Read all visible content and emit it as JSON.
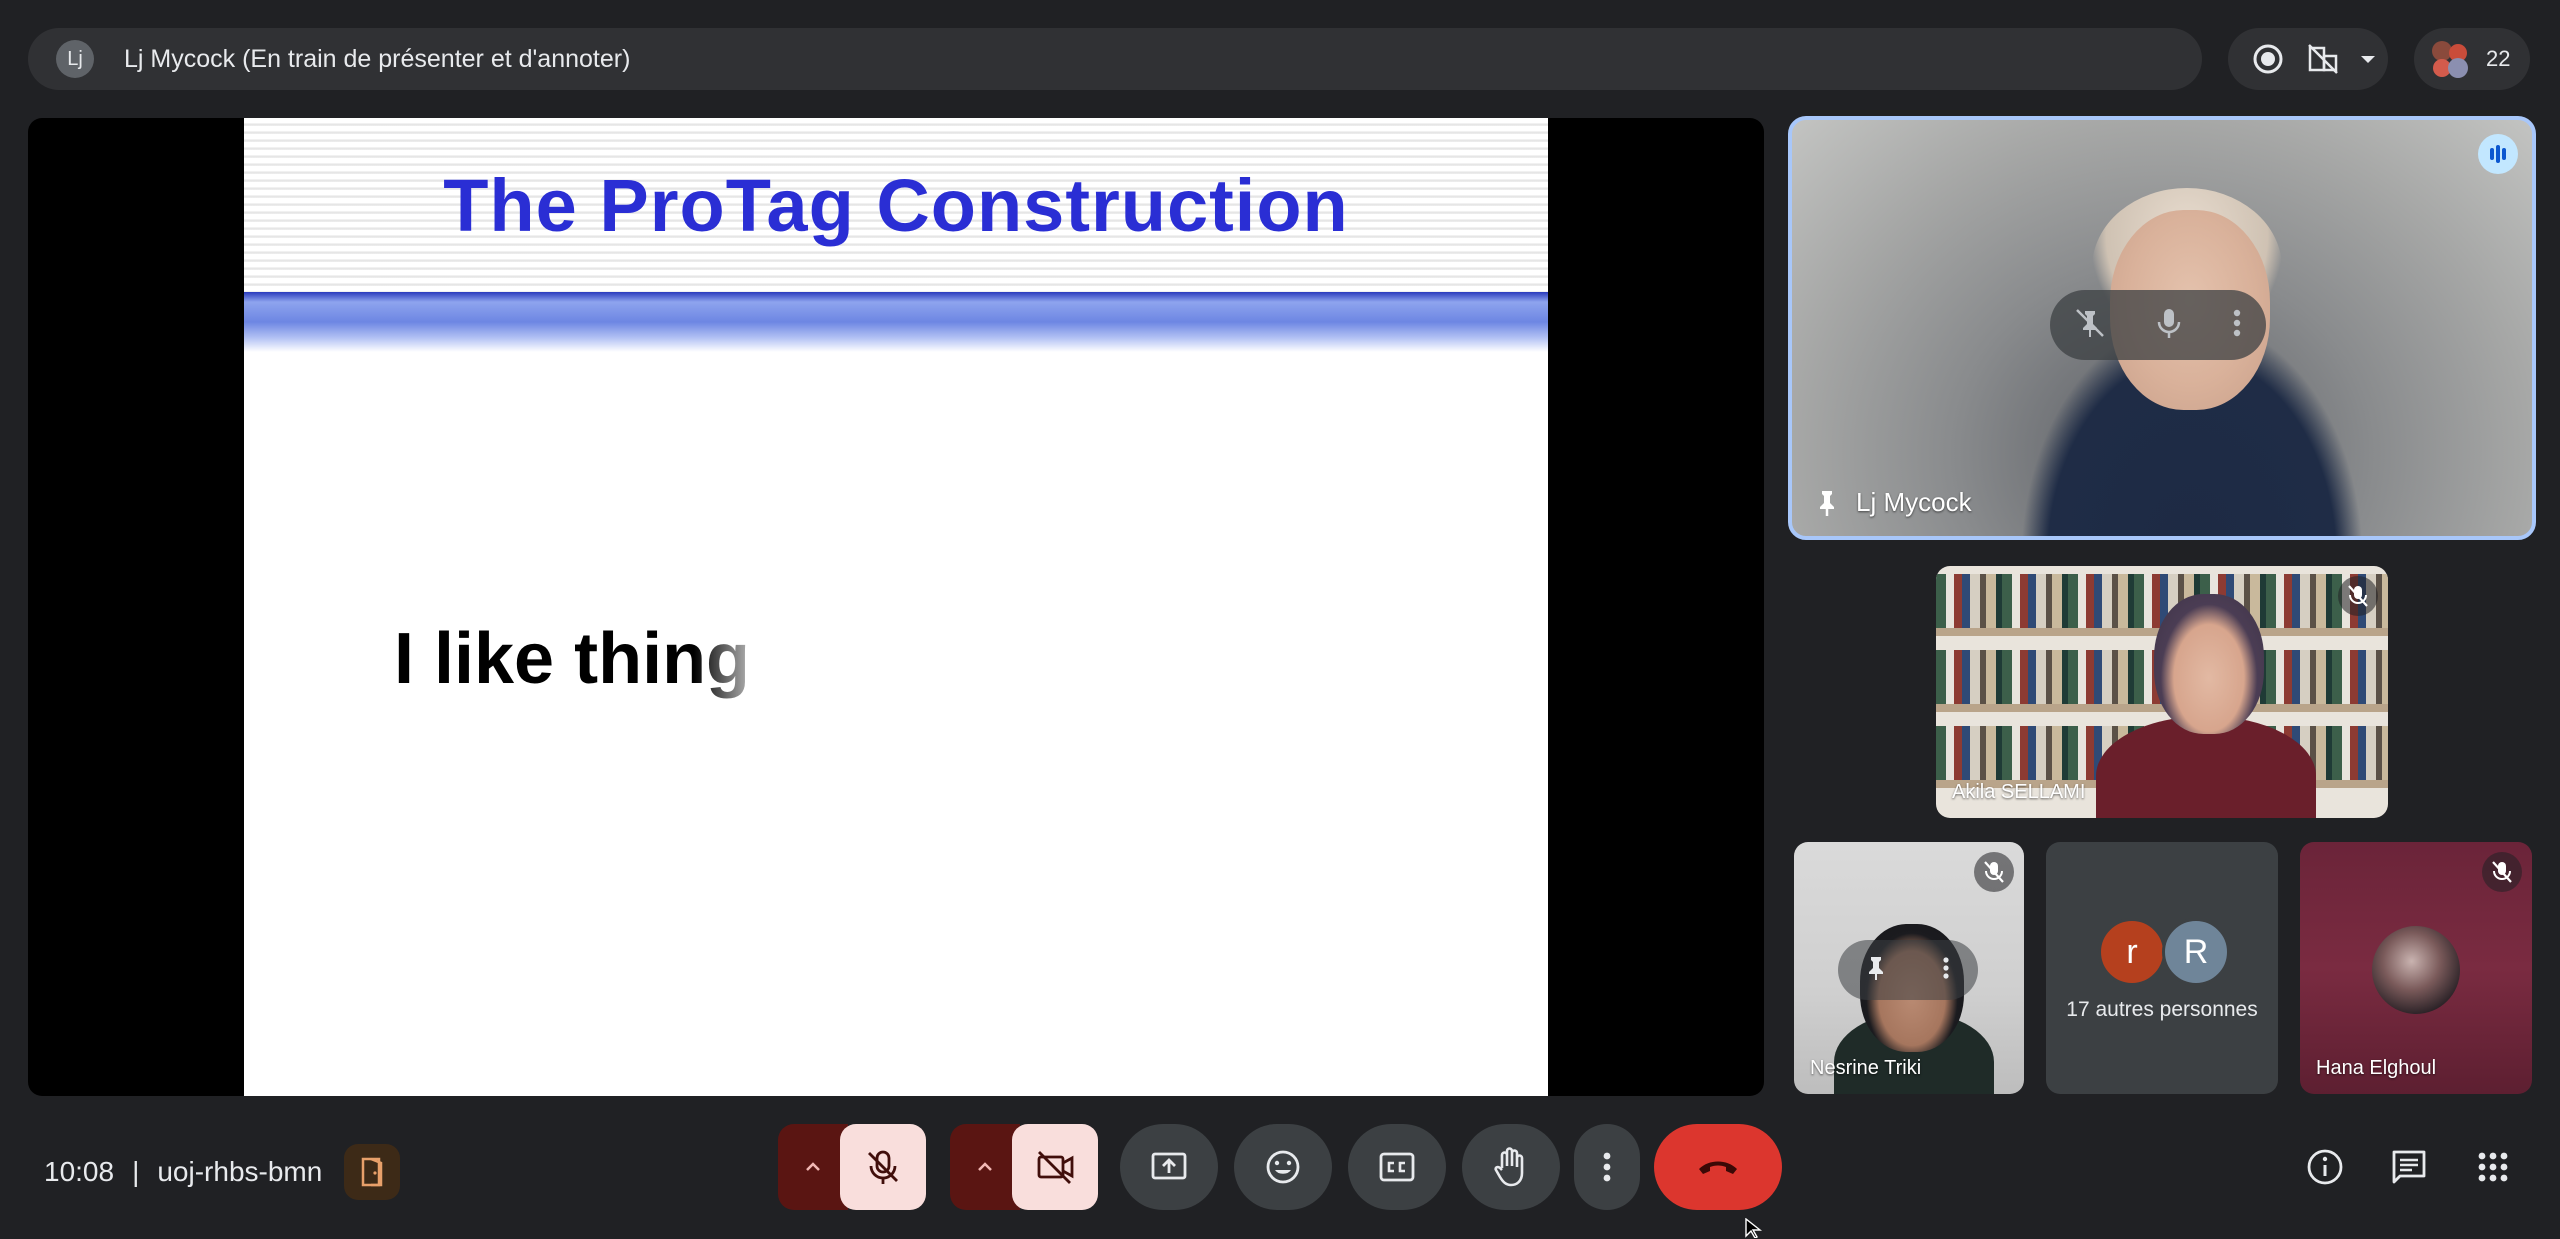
{
  "presenter_bar": {
    "avatar_initials": "Lj",
    "text": "Lj Mycock (En train de présenter et d'annoter)"
  },
  "toolbar_top": {
    "record_icon": "record-icon",
    "layout_icon": "layout-off-icon",
    "participant_count": "22"
  },
  "slide": {
    "title": "The ProTag Construction",
    "body_text": "I like thing"
  },
  "tiles": {
    "main": {
      "name": "Lj Mycock",
      "pinned": true,
      "speaking": true
    },
    "akila": {
      "name": "Akila SELLAMI",
      "muted": true
    },
    "nesrine": {
      "name": "Nesrine Triki",
      "muted": true
    },
    "others": {
      "avatar_1": "r",
      "avatar_2": "R",
      "label": "17 autres personnes",
      "avatar_1_color": "#b5401e",
      "avatar_2_color": "#6f8599"
    },
    "hana": {
      "name": "Hana Elghoul",
      "muted": true
    }
  },
  "bottom_bar": {
    "time": "10:08",
    "separator": "|",
    "meeting_code": "uoj-rhbs-bmn"
  },
  "colors": {
    "background": "#202124",
    "surface": "#303134",
    "accent_blue": "#a8c7fa",
    "end_call_red": "#dc362e",
    "slide_title_blue": "#2a2ed4"
  }
}
